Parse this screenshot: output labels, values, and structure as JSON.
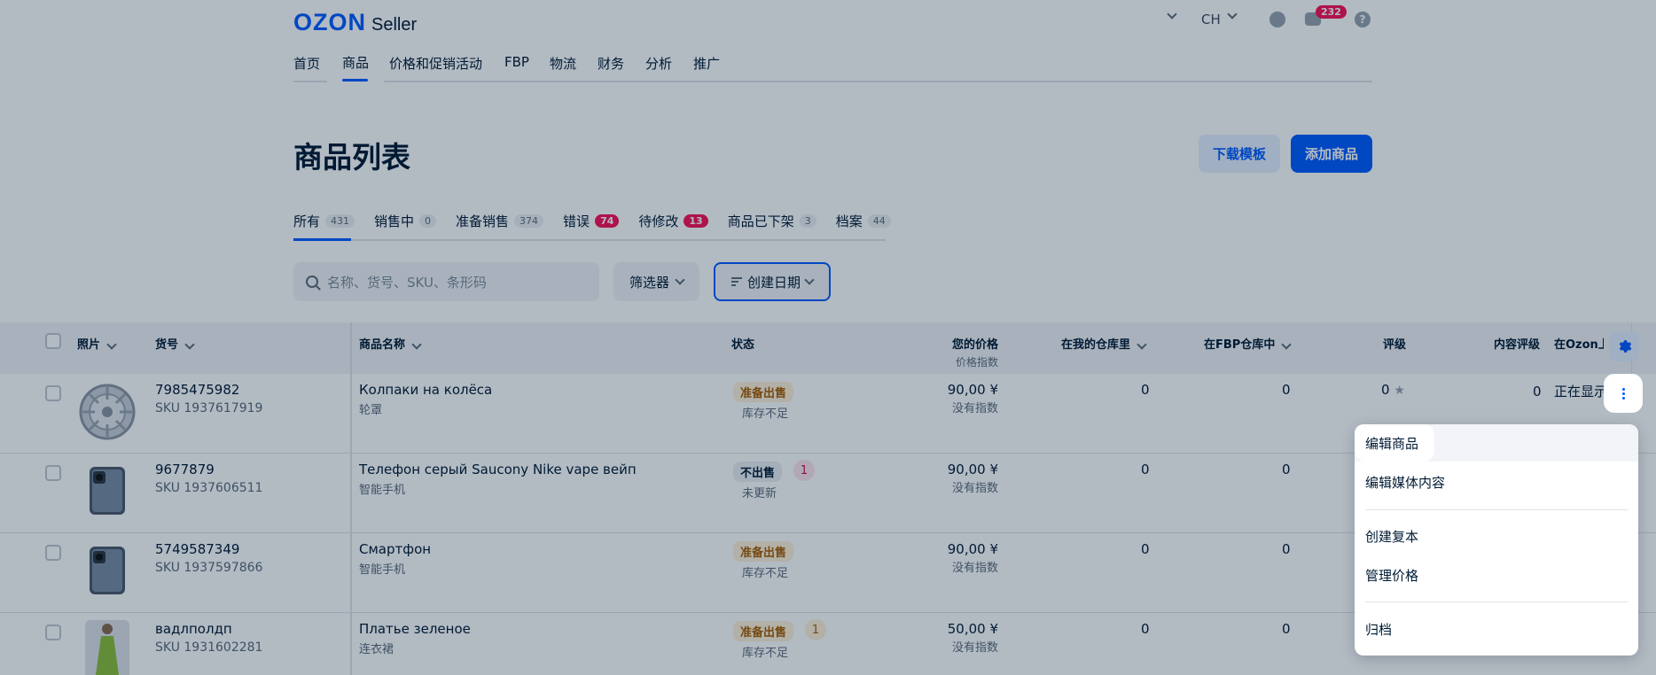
{
  "header": {
    "logo_ozon": "OZON",
    "logo_seller": "Seller",
    "lang": "CH",
    "messages_badge": "232"
  },
  "nav": {
    "items": [
      "首页",
      "商品",
      "价格和促销活动",
      "FBP",
      "物流",
      "财务",
      "分析",
      "推广"
    ],
    "active": "商品"
  },
  "page": {
    "title": "商品列表",
    "download_template": "下载模板",
    "add_product": "添加商品"
  },
  "tabs": [
    {
      "label": "所有",
      "count": "431"
    },
    {
      "label": "销售中",
      "count": "0"
    },
    {
      "label": "准备销售",
      "count": "374"
    },
    {
      "label": "错误",
      "count": "74"
    },
    {
      "label": "待修改",
      "count": "13"
    },
    {
      "label": "商品已下架",
      "count": "3"
    },
    {
      "label": "档案",
      "count": "44"
    }
  ],
  "filters": {
    "search_placeholder": "名称、货号、SKU、条形码",
    "filter_label": "筛选器",
    "sort_label": "创建日期"
  },
  "table": {
    "headers": {
      "photo": "照片",
      "article": "货号",
      "name": "商品名称",
      "status": "状态",
      "price": "您的价格",
      "price_sub": "价格指数",
      "my_stock": "在我的仓库里",
      "fbp_stock": "在FBP仓库中",
      "rating": "评级",
      "content_rating": "内容评级",
      "ozon": "在Ozon上"
    },
    "rows": [
      {
        "article": "7985475982",
        "sku": "SKU 1937617919",
        "name": "Колпаки на колёса",
        "category": "轮罩",
        "status": "准备出售",
        "status_sub": "库存不足",
        "issues": "",
        "price": "90,00 ¥",
        "price_sub": "没有指数",
        "my_stock": "0",
        "fbp_stock": "0",
        "rating": "0",
        "content_rating": "0",
        "ozon": "正在显示"
      },
      {
        "article": "9677879",
        "sku": "SKU 1937606511",
        "name": "Телефон серый Saucony Nike vape вейп",
        "category": "智能手机",
        "status": "不出售",
        "status_sub": "未更新",
        "issues": "1",
        "price": "90,00 ¥",
        "price_sub": "没有指数",
        "my_stock": "0",
        "fbp_stock": "0"
      },
      {
        "article": "5749587349",
        "sku": "SKU 1937597866",
        "name": "Смартфон",
        "category": "智能手机",
        "status": "准备出售",
        "status_sub": "库存不足",
        "issues": "",
        "price": "90,00 ¥",
        "price_sub": "没有指数",
        "my_stock": "0",
        "fbp_stock": "0"
      },
      {
        "article": "вадлполдп",
        "sku": "SKU 1931602281",
        "name": "Платье зеленое",
        "category": "连衣裙",
        "status": "准备出售",
        "status_sub": "库存不足",
        "issues": "1",
        "price": "50,00 ¥",
        "price_sub": "没有指数",
        "my_stock": "0",
        "fbp_stock": "0"
      }
    ]
  },
  "context_menu": {
    "items": [
      "编辑商品",
      "编辑媒体内容",
      "创建复本",
      "管理价格",
      "归档"
    ]
  },
  "colors": {
    "accent": "#005bff",
    "badge_red": "#f91155",
    "ready_bg": "#fff1d9",
    "ready_text": "#a85e00"
  }
}
